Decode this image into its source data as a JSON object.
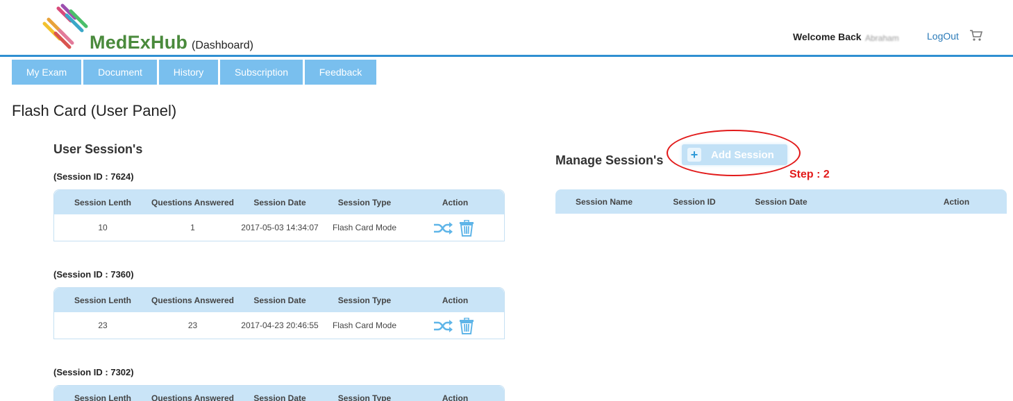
{
  "header": {
    "logo_text": "MedExHub",
    "logo_subtitle": "(Dashboard)",
    "welcome": "Welcome Back",
    "username": "Abraham",
    "logout": "LogOut",
    "cart_icon": "cart-icon",
    "accent_color": "#2f8fd1"
  },
  "nav": {
    "tabs": [
      {
        "label": "My Exam"
      },
      {
        "label": "Document"
      },
      {
        "label": "History"
      },
      {
        "label": "Subscription"
      },
      {
        "label": "Feedback"
      }
    ],
    "tab_color": "#79bfee"
  },
  "page_title": "Flash Card (User Panel)",
  "user_sessions": {
    "title": "User Session's",
    "columns": [
      "Session Lenth",
      "Questions Answered",
      "Session Date",
      "Session Type",
      "Action"
    ],
    "action_icons": [
      "shuffle-icon",
      "trash-icon"
    ],
    "sessions": [
      {
        "id_label": "(Session ID : 7624)",
        "row": [
          "10",
          "1",
          "2017-05-03 14:34:07",
          "Flash Card Mode"
        ]
      },
      {
        "id_label": "(Session ID : 7360)",
        "row": [
          "23",
          "23",
          "2017-04-23 20:46:55",
          "Flash Card Mode"
        ]
      },
      {
        "id_label": "(Session ID : 7302)"
      }
    ]
  },
  "manage_sessions": {
    "title": "Manage Session's",
    "add_button": "Add Session",
    "add_icon": "plus-icon",
    "step_label": "Step : 2",
    "annotation_color": "#e21a1a",
    "columns": [
      "Session Name",
      "Session ID",
      "Session Date",
      "Action"
    ]
  }
}
